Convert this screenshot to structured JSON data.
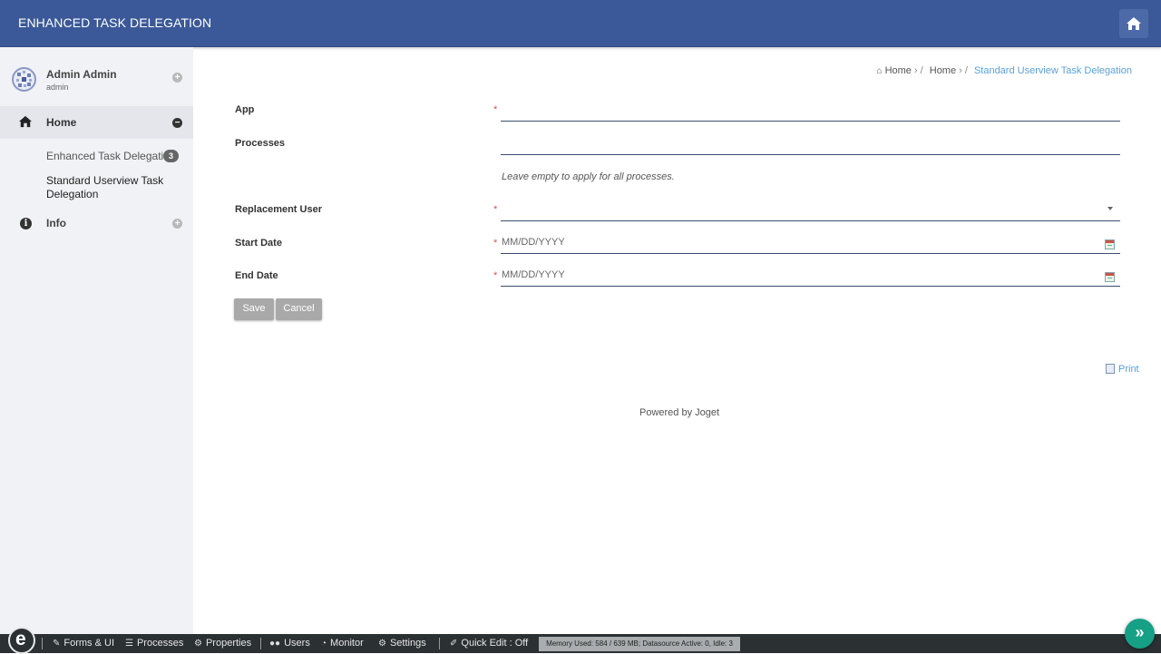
{
  "header": {
    "title": "ENHANCED TASK DELEGATION"
  },
  "profile": {
    "name": "Admin Admin",
    "username": "admin"
  },
  "sidebar": {
    "home_label": "Home",
    "items": [
      {
        "label": "Enhanced Task Delegation",
        "badge": "3"
      },
      {
        "label": "Standard Userview Task Delegation"
      }
    ],
    "info_label": "Info"
  },
  "breadcrumb": {
    "item1": "Home",
    "item2": "Home",
    "current": "Standard Userview Task Delegation"
  },
  "form": {
    "app_label": "App",
    "processes_label": "Processes",
    "processes_hint": "Leave empty to apply for all processes.",
    "replacement_user_label": "Replacement User",
    "start_date_label": "Start Date",
    "start_date_placeholder": "MM/DD/YYYY",
    "end_date_label": "End Date",
    "end_date_placeholder": "MM/DD/YYYY",
    "required_mark": "*",
    "save_label": "Save",
    "cancel_label": "Cancel"
  },
  "print_label": "Print",
  "footer": {
    "powered_by": "Powered by Joget"
  },
  "bottombar": {
    "forms_ui": "Forms & UI",
    "processes": "Processes",
    "properties": "Properties",
    "users": "Users",
    "monitor": "Monitor",
    "settings": "Settings",
    "quick_edit": "Quick Edit : Off",
    "memory": "Memory Used: 584 / 639 MB; Datasource Active: 0, Idle: 3"
  },
  "colors": {
    "header": "#3b5998",
    "sidebar": "#f1f2f6",
    "link": "#5aa0d8",
    "required": "#d9534f",
    "fab": "#16a085"
  }
}
